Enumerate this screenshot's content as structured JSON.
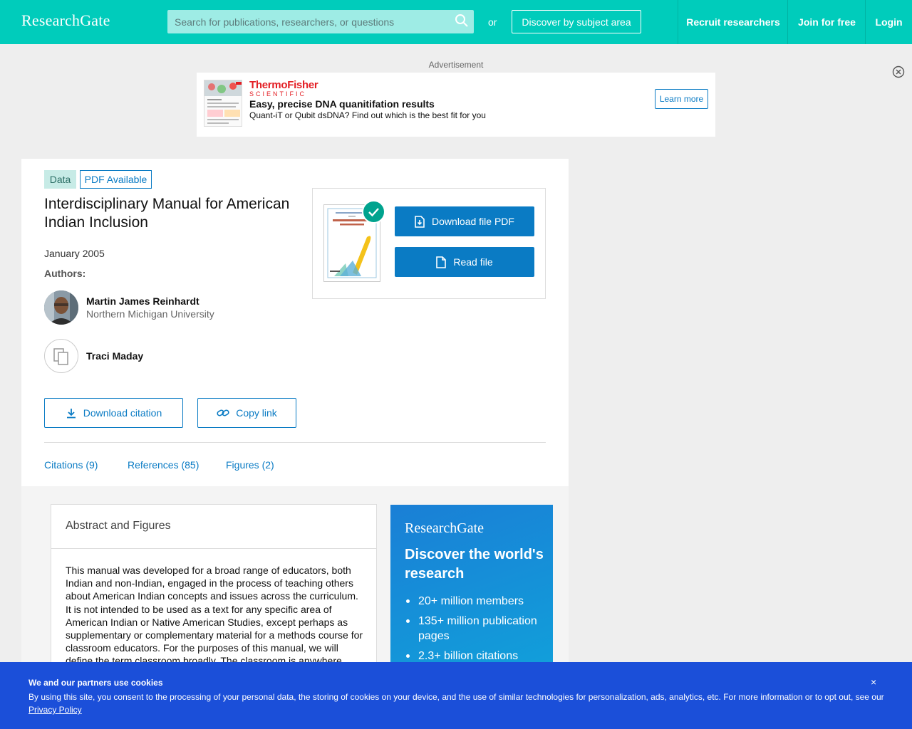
{
  "header": {
    "logo": "ResearchGate",
    "search_placeholder": "Search for publications, researchers, or questions",
    "or_text": "or",
    "discover_label": "Discover by subject area",
    "nav": [
      "Recruit researchers",
      "Join for free",
      "Login"
    ]
  },
  "ad": {
    "label": "Advertisement",
    "brand_line1": "ThermoFisher",
    "brand_line2": "SCIENTIFIC",
    "headline": "Easy, precise DNA quanitifation results",
    "subline": "Quant-iT or Qubit dsDNA? Find out which is the best fit for you",
    "cta": "Learn more"
  },
  "publication": {
    "badges": [
      "Data",
      "PDF Available"
    ],
    "title": "Interdisciplinary Manual for American Indian Inclusion",
    "date": "January 2005",
    "authors_label": "Authors:",
    "authors": [
      {
        "name": "Martin James Reinhardt",
        "institution": "Northern Michigan University"
      },
      {
        "name": "Traci Maday",
        "institution": ""
      }
    ],
    "download_citation": "Download citation",
    "copy_link": "Copy link",
    "tabs": [
      "Citations (9)",
      "References (85)",
      "Figures (2)"
    ]
  },
  "file_panel": {
    "download_pdf": "Download file PDF",
    "read_file": "Read file"
  },
  "abstract": {
    "heading": "Abstract and Figures",
    "text": "This manual was developed for a broad range of educators, both Indian and non-Indian, engaged in the process of teaching others about American Indian concepts and issues across the curriculum. It is not intended to be used as a text for any specific area of American Indian or Native American Studies, except perhaps as supplementary or complementary material for a methods course for classroom educators. For the purposes of this manual, we will define the term classroom broadly. The classroom is anywhere"
  },
  "promo": {
    "logo": "ResearchGate",
    "headline": "Discover the world's research",
    "items": [
      "20+ million members",
      "135+ million publication pages",
      "2.3+ billion citations"
    ]
  },
  "cookie": {
    "title": "We and our partners use cookies",
    "text": "By using this site, you consent to the processing of your personal data, the storing of cookies on your device, and the use of similar technologies for personalization, ads, analytics, etc. For more information or to opt out, see our",
    "link": "Privacy Policy",
    "close": "×"
  },
  "colors": {
    "brand_teal": "#00ccbb",
    "link_blue": "#0a7bc4",
    "cookie_blue": "#1b4fd9",
    "check_green": "#00a38e"
  }
}
